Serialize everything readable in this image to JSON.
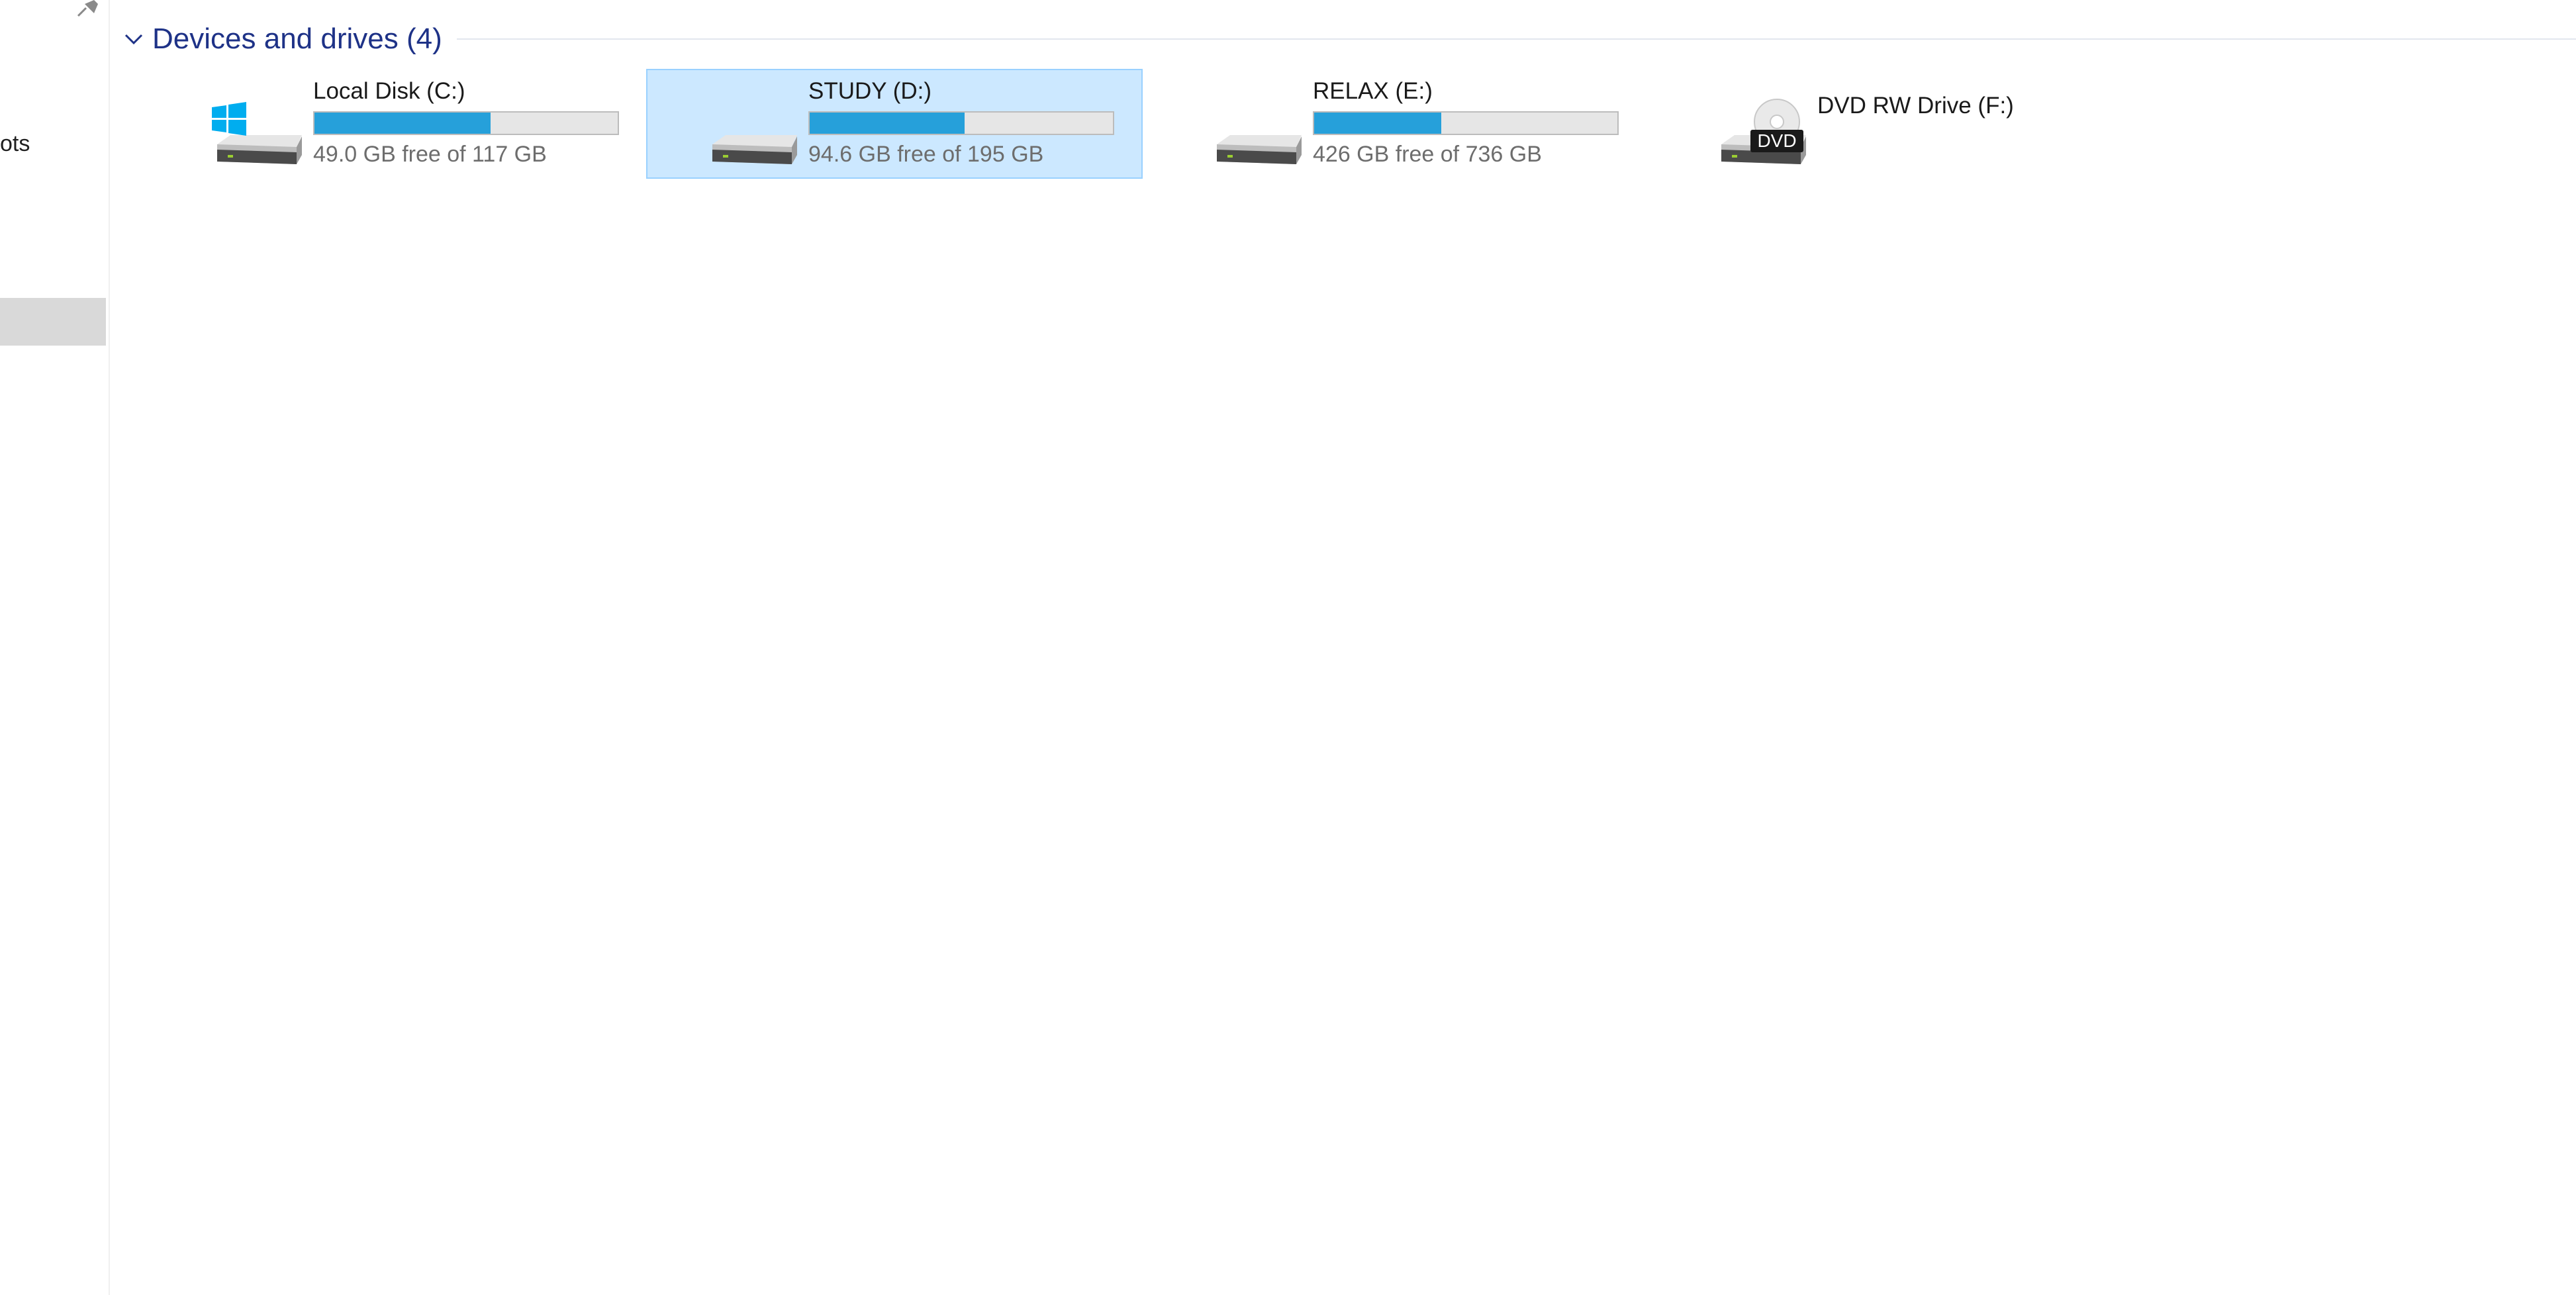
{
  "nav": {
    "partial_item_text": "ots"
  },
  "group": {
    "title": "Devices and drives (4)"
  },
  "drives": [
    {
      "name": "Local Disk (C:)",
      "free_text": "49.0 GB free of 117 GB",
      "used_fraction": 0.58,
      "icon": "windows-drive-icon"
    },
    {
      "name": "STUDY (D:)",
      "free_text": "94.6 GB free of 195 GB",
      "used_fraction": 0.51,
      "icon": "hard-drive-icon"
    },
    {
      "name": "RELAX (E:)",
      "free_text": "426 GB free of 736 GB",
      "used_fraction": 0.42,
      "icon": "hard-drive-icon"
    },
    {
      "name": "DVD RW Drive (F:)",
      "icon": "dvd-drive-icon",
      "badge": "DVD"
    }
  ],
  "colors": {
    "accent": "#26a0da",
    "selection_bg": "#cce8ff",
    "selection_border": "#99d1ff",
    "group_title": "#1e3287"
  }
}
